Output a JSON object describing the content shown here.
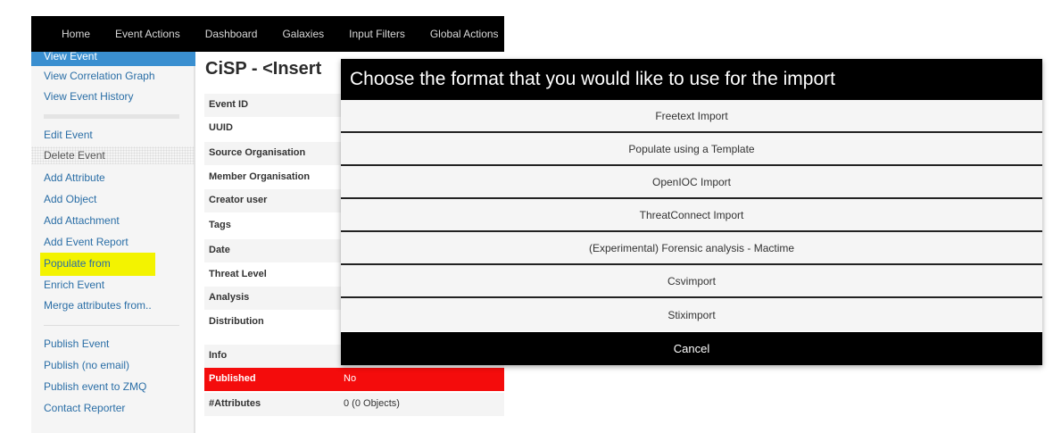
{
  "nav": {
    "items": [
      "Home",
      "Event Actions",
      "Dashboard",
      "Galaxies",
      "Input Filters",
      "Global Actions"
    ]
  },
  "sidebar": {
    "active": "View Event",
    "items": [
      "View Correlation Graph",
      "View Event History",
      "Edit Event",
      "Delete Event",
      "Add Attribute",
      "Add Object",
      "Add Attachment",
      "Add Event Report",
      "Populate from",
      "Enrich Event",
      "Merge attributes from..",
      "Publish Event",
      "Publish (no email)",
      "Publish event to ZMQ",
      "Contact Reporter"
    ]
  },
  "main": {
    "title": "CiSP - <Insert"
  },
  "details": {
    "rows": [
      {
        "key": "Event ID",
        "value": ""
      },
      {
        "key": "UUID",
        "value": ""
      },
      {
        "key": "Source Organisation",
        "value": ""
      },
      {
        "key": "Member Organisation",
        "value": ""
      },
      {
        "key": "Creator user",
        "value": ""
      },
      {
        "key": "Tags",
        "value": ""
      },
      {
        "key": "Date",
        "value": ""
      },
      {
        "key": "Threat Level",
        "value": ""
      },
      {
        "key": "Analysis",
        "value": ""
      },
      {
        "key": "Distribution",
        "value": ""
      },
      {
        "key": "Info",
        "value": ""
      },
      {
        "key": "Published",
        "value": "No"
      },
      {
        "key": "#Attributes",
        "value": "0 (0 Objects)"
      }
    ]
  },
  "modal": {
    "title": "Choose the format that you would like to use for the import",
    "options": [
      "Freetext Import",
      "Populate using a Template",
      "OpenIOC Import",
      "ThreatConnect Import",
      "(Experimental) Forensic analysis - Mactime",
      "Csvimport",
      "Stiximport"
    ],
    "cancel": "Cancel"
  },
  "colors": {
    "nav_bg": "#000000",
    "sidebar_active": "#3a8fd0",
    "link": "#2a6ea6",
    "highlight": "#f3f300",
    "published_bg": "#f40c0c",
    "modal_header": "#000000"
  }
}
